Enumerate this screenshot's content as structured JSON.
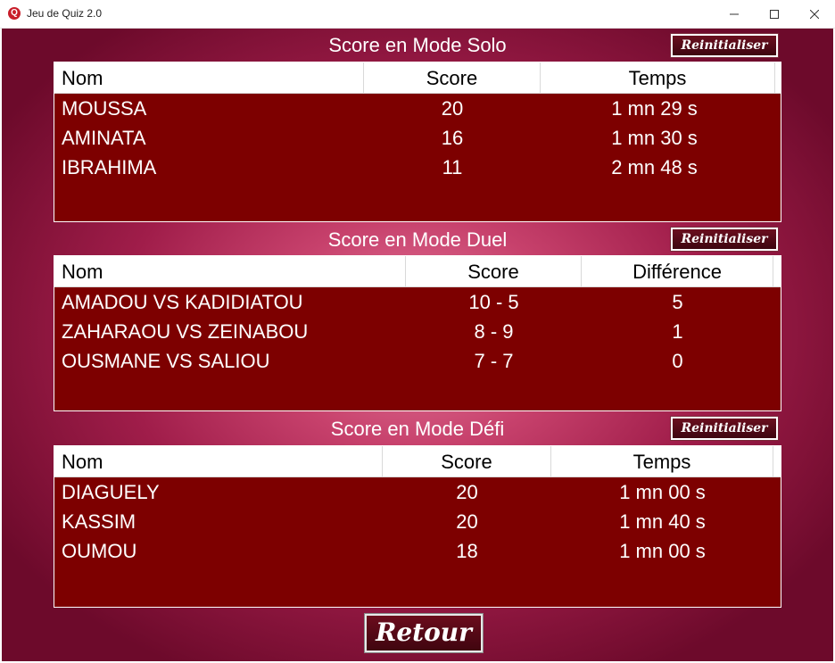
{
  "window": {
    "title": "Jeu de Quiz 2.0",
    "icon_letter": "Q"
  },
  "reset_label": "Reinitialiser",
  "back_label": "Retour",
  "solo": {
    "title": "Score en Mode Solo",
    "headers": [
      "Nom",
      "Score",
      "Temps"
    ],
    "rows": [
      [
        "MOUSSA",
        "20",
        "1 mn 29 s"
      ],
      [
        "AMINATA",
        "16",
        "1 mn 30 s"
      ],
      [
        "IBRAHIMA",
        "11",
        "2 mn 48 s"
      ]
    ]
  },
  "duel": {
    "title": "Score en Mode Duel",
    "headers": [
      "Nom",
      "Score",
      "Différence"
    ],
    "rows": [
      [
        "AMADOU VS KADIDIATOU",
        "10 - 5",
        "5"
      ],
      [
        "ZAHARAOU VS ZEINABOU",
        "8 - 9",
        "1"
      ],
      [
        "OUSMANE VS SALIOU",
        "7 - 7",
        "0"
      ]
    ]
  },
  "defi": {
    "title": "Score en Mode Défi",
    "headers": [
      "Nom",
      "Score",
      "Temps"
    ],
    "rows": [
      [
        "DIAGUELY",
        "20",
        "1 mn 00 s"
      ],
      [
        "KASSIM",
        "20",
        "1 mn 40 s"
      ],
      [
        "OUMOU",
        "18",
        "1 mn 00 s"
      ]
    ]
  },
  "colors": {
    "table_bg": "#7d0000",
    "bg_center": "#e47a9c",
    "bg_edge": "#6d0a2b"
  }
}
